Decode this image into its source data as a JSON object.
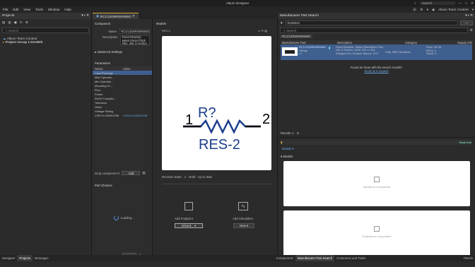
{
  "app": {
    "title": "Altium Designer"
  },
  "menu": [
    "File",
    "Edit",
    "View",
    "Tools",
    "Window",
    "Help"
  ],
  "topbar": {
    "search": "Search",
    "account": "Altium Team Content"
  },
  "projects": {
    "title": "Projects",
    "search_placeholder": "Search",
    "items": [
      "Altium Team Content",
      "Project Group 1.DsnWrk"
    ]
  },
  "doctab": {
    "label": "RC1/12D5R0N0WBG"
  },
  "component": {
    "title": "Component",
    "name_label": "Name",
    "name_value": "RC1/12D5R0N0WBG",
    "desc_label": "Description",
    "desc_value": "Fixed Resistor, Metal Glaze/Thick Film, 2W, 5 %/ohm, ...",
    "adv": "Advanced Settings"
  },
  "parameters": {
    "title": "Parameters",
    "col_name": "Name",
    "col_value": "Value",
    "rows": [
      "Case/Package",
      "Max Operatin...",
      "Min Operatin...",
      "Mounting Te...",
      "Pins",
      "Power",
      "RoHS Complia...",
      "Tolerance",
      "Value",
      "Voltage Rating",
      "VISH-5-400001236"
    ],
    "link_value": "VISH-5-400001236",
    "drop_label": "Drop component #",
    "drop_btn": "Add"
  },
  "part_choices": {
    "title": "Part Choices",
    "loading": "Loading..."
  },
  "models": {
    "title": "Models",
    "symbol_name": "RES-2",
    "designator": "R?",
    "pin1": "1",
    "pin2": "2",
    "revision": "Revision State:",
    "rev_val": "2 · Draft · Up to date",
    "add_footprint": "Add Footprint",
    "add_simulation": "Add Simulation",
    "wizard": "Wizard...",
    "new": "New"
  },
  "mps": {
    "title": "Manufacturer Part Search",
    "filter": "Resistors",
    "search": "Search",
    "breadcrumb": "RC1/12D5R0N0WBG",
    "cols": [
      "Manufacturer Part",
      "Description",
      "Category",
      "Supply Info"
    ],
    "part": "RC1/12D5R0N0WBG",
    "mfr": "Vishay",
    "desc": "Fixed Resistor, Metal Glaze/thick Film, 2W, 5 %/ohm, 200V, SG => Rd, 200ppm/Cel, Surface Mount, 1217",
    "category": "Chip SMD Resistors",
    "price": "Price: $0.35",
    "moq": "MOQ: 1",
    "stock": "Stock: 0",
    "issue": "Found an issue with the search results?",
    "report": "Send us a request",
    "results": "Results: 1",
    "models_title": "Models",
    "symbol_np": "Symbol is not present",
    "footprint_np": "Footprint is not present",
    "status": "Stock info"
  },
  "status_left": [
    "Navigator",
    "Projects",
    "Messages"
  ],
  "status_right": [
    "Components",
    "Manufacturer Part Search",
    "Comments and Tasks"
  ],
  "panels": "Panels"
}
